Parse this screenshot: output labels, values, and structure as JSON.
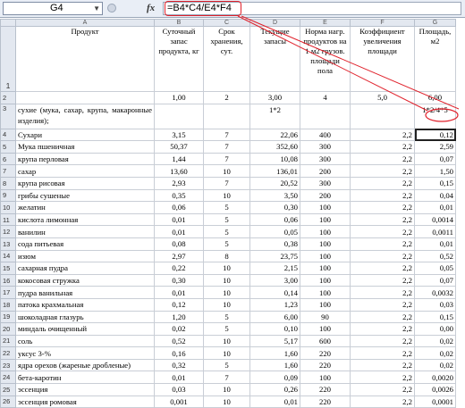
{
  "formula_bar": {
    "name_box": "G4",
    "fx_label": "fx",
    "formula": "=B4*C4/E4*F4"
  },
  "columns": [
    "A",
    "B",
    "C",
    "D",
    "E",
    "F",
    "G"
  ],
  "header": {
    "row_num": "1",
    "a": "Продукт",
    "b": "Суточный запас продукта, кг",
    "c": "Срок хранения, сут.",
    "d": "Текущие запасы",
    "e": "Норма нагр. продуктов на 1 м2 грузов. площади пола",
    "f": "Коэффициент увеличения площади",
    "g": "Площадь, м2"
  },
  "row2": {
    "num": "2",
    "b": "1,00",
    "c": "2",
    "d": "3,00",
    "e": "4",
    "f": "5,0",
    "g": "6,00"
  },
  "row3": {
    "num": "3",
    "a": "сухие (мука, сахар, крупа, макаронные изделия);",
    "d": "1*2",
    "g": "1*2/4*5"
  },
  "rows": [
    {
      "num": "4",
      "a": "Сухари",
      "b": "3,15",
      "c": "7",
      "d": "22,06",
      "e": "400",
      "f": "2,2",
      "g": "0,12"
    },
    {
      "num": "5",
      "a": "Мука пшеничная",
      "b": "50,37",
      "c": "7",
      "d": "352,60",
      "e": "300",
      "f": "2,2",
      "g": "2,59"
    },
    {
      "num": "6",
      "a": "крупа перловая",
      "b": "1,44",
      "c": "7",
      "d": "10,08",
      "e": "300",
      "f": "2,2",
      "g": "0,07"
    },
    {
      "num": "7",
      "a": "сахар",
      "b": "13,60",
      "c": "10",
      "d": "136,01",
      "e": "200",
      "f": "2,2",
      "g": "1,50"
    },
    {
      "num": "8",
      "a": "крупа рисовая",
      "b": "2,93",
      "c": "7",
      "d": "20,52",
      "e": "300",
      "f": "2,2",
      "g": "0,15"
    },
    {
      "num": "9",
      "a": "грибы сушеные",
      "b": "0,35",
      "c": "10",
      "d": "3,50",
      "e": "200",
      "f": "2,2",
      "g": "0,04"
    },
    {
      "num": "10",
      "a": "желатин",
      "b": "0,06",
      "c": "5",
      "d": "0,30",
      "e": "100",
      "f": "2,2",
      "g": "0,01"
    },
    {
      "num": "11",
      "a": "кислота лимонная",
      "b": "0,01",
      "c": "5",
      "d": "0,06",
      "e": "100",
      "f": "2,2",
      "g": "0,0014"
    },
    {
      "num": "12",
      "a": "ванилин",
      "b": "0,01",
      "c": "5",
      "d": "0,05",
      "e": "100",
      "f": "2,2",
      "g": "0,0011"
    },
    {
      "num": "13",
      "a": "сода питьевая",
      "b": "0,08",
      "c": "5",
      "d": "0,38",
      "e": "100",
      "f": "2,2",
      "g": "0,01"
    },
    {
      "num": "14",
      "a": "изюм",
      "b": "2,97",
      "c": "8",
      "d": "23,75",
      "e": "100",
      "f": "2,2",
      "g": "0,52"
    },
    {
      "num": "15",
      "a": "сахарная пудра",
      "b": "0,22",
      "c": "10",
      "d": "2,15",
      "e": "100",
      "f": "2,2",
      "g": "0,05"
    },
    {
      "num": "16",
      "a": "кокосовая стружка",
      "b": "0,30",
      "c": "10",
      "d": "3,00",
      "e": "100",
      "f": "2,2",
      "g": "0,07"
    },
    {
      "num": "17",
      "a": "пудра ванильная",
      "b": "0,01",
      "c": "10",
      "d": "0,14",
      "e": "100",
      "f": "2,2",
      "g": "0,0032"
    },
    {
      "num": "18",
      "a": "патока крахмальная",
      "b": "0,12",
      "c": "10",
      "d": "1,23",
      "e": "100",
      "f": "2,2",
      "g": "0,03"
    },
    {
      "num": "19",
      "a": "шоколадная глазурь",
      "b": "1,20",
      "c": "5",
      "d": "6,00",
      "e": "90",
      "f": "2,2",
      "g": "0,15"
    },
    {
      "num": "20",
      "a": "миндаль очищенный",
      "b": "0,02",
      "c": "5",
      "d": "0,10",
      "e": "100",
      "f": "2,2",
      "g": "0,00"
    },
    {
      "num": "21",
      "a": "соль",
      "b": "0,52",
      "c": "10",
      "d": "5,17",
      "e": "600",
      "f": "2,2",
      "g": "0,02"
    },
    {
      "num": "22",
      "a": "уксус 3-%",
      "b": "0,16",
      "c": "10",
      "d": "1,60",
      "e": "220",
      "f": "2,2",
      "g": "0,02"
    },
    {
      "num": "23",
      "a": "ядра орехов (жареные дробленые)",
      "b": "0,32",
      "c": "5",
      "d": "1,60",
      "e": "220",
      "f": "2,2",
      "g": "0,02"
    },
    {
      "num": "24",
      "a": "бета-каротин",
      "b": "0,01",
      "c": "7",
      "d": "0,09",
      "e": "100",
      "f": "2,2",
      "g": "0,0020"
    },
    {
      "num": "25",
      "a": "эссенция",
      "b": "0,03",
      "c": "10",
      "d": "0,26",
      "e": "220",
      "f": "2,2",
      "g": "0,0026"
    },
    {
      "num": "26",
      "a": "эссенция ромовая",
      "b": "0,001",
      "c": "10",
      "d": "0,01",
      "e": "220",
      "f": "2,2",
      "g": "0,0001"
    }
  ],
  "colors": {
    "highlight": "#e0202a",
    "header_bg": "#e3e8f0"
  }
}
